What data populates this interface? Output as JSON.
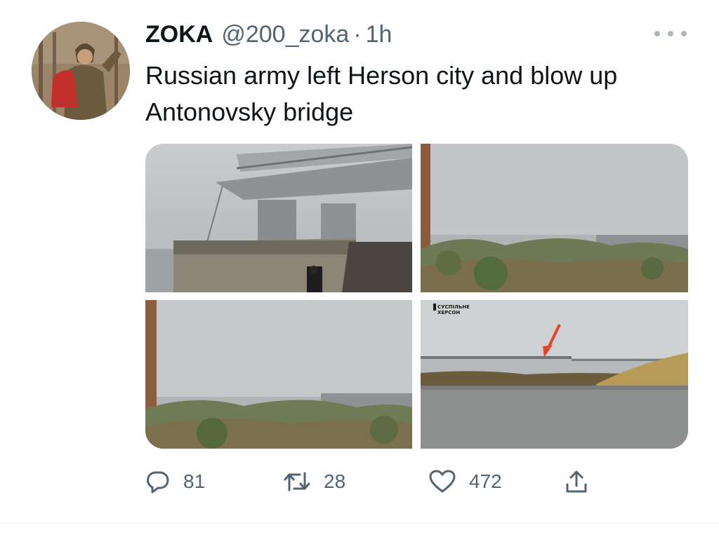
{
  "tweet": {
    "author_name": "ZOKA",
    "author_handle": "@200_zoka",
    "separator": "·",
    "time": "1h",
    "text": "Russian army left Herson city and blow up Antonovsky bridge"
  },
  "media": {
    "photo_count": 4,
    "watermark": "СУСПІЛЬНЕ\nХЕРСОН",
    "arrow_color": "#e8432a"
  },
  "actions": {
    "replies": "81",
    "retweets": "28",
    "likes": "472"
  },
  "colors": {
    "text_primary": "#0f1419",
    "text_secondary": "#536471",
    "divider": "#eff3f4"
  },
  "icons": [
    "more-icon",
    "reply-icon",
    "retweet-icon",
    "like-icon",
    "share-icon"
  ]
}
